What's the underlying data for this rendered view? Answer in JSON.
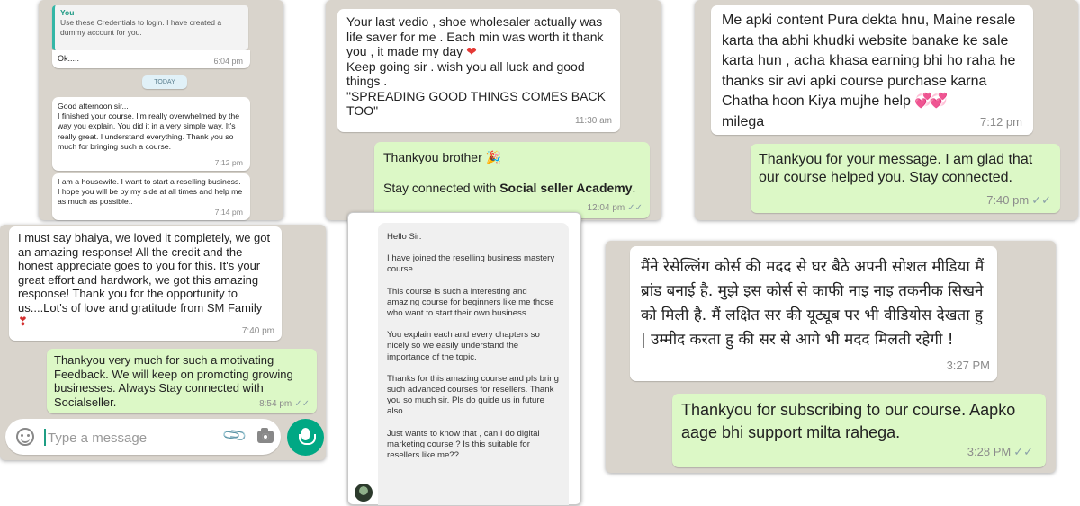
{
  "screenshot1": {
    "quote_author": "You",
    "quote_text": "Use these Credentials to login. I have created a dummy account for you.",
    "reply_text": "Ok.....",
    "reply_time": "6:04 pm",
    "date_separator": "TODAY",
    "msg1_text": "Good afternoon  sir...\n I finished your course. I'm really overwhelmed by the way you explain. You did it in a very simple way. It's really great. I understand everything. Thank you so much for bringing such a course.",
    "msg1_time": "7:12 pm",
    "msg2_text": "I am a housewife. I want to start a reselling business. I hope you will be by my side at all times and help me as much as possible..",
    "msg2_time": "7:14 pm"
  },
  "screenshot2": {
    "msg1_text": "Your last vedio , shoe wholesaler actually was life saver for me . Each min was  worth it thank you , it made my day",
    "msg1_heart": "❤",
    "msg1_text2": "Keep going sir . wish you all luck and good things .\n\"SPREADING GOOD THINGS COMES BACK TOO\"",
    "msg1_time": "11:30 am",
    "msg2_line1": "Thankyou brother",
    "msg2_emoji": "🎉",
    "msg2_line2_prefix": "Stay connected with ",
    "msg2_brand": "Social seller Academy",
    "msg2_line2_suffix": ".",
    "msg2_time": "12:04 pm",
    "ticks": "✓✓"
  },
  "screenshot3": {
    "msg1_text": "Me apki content  Pura dekta hnu, Maine resale karta tha abhi khudki website banake ke sale karta hun , acha khasa earning bhi ho raha he thanks sir avi apki course purchase karna Chatha hoon Kiya mujhe help",
    "msg1_emoji": "💞💞",
    "msg1_text2": "milega",
    "msg1_time": "7:12 pm",
    "msg2_text": "Thankyou for your message. I am glad that our course helped you. Stay connected.",
    "msg2_time": "7:40 pm",
    "ticks": "✓✓"
  },
  "screenshot4": {
    "msg1_text": "I must say bhaiya, we loved it completely, we got an amazing response! All the credit and the honest appreciate goes to you for this. It's your great effort and hardwork, we got this amazing response! Thank you for the opportunity to us....Lot's of love and gratitude from SM Family",
    "msg1_emoji": "❣",
    "msg1_time": "7:40 pm",
    "msg2_text": "Thankyou very much for such a motivating Feedback. We will keep on promoting growing businesses. Always Stay connected with Socialseller.",
    "msg2_time": "8:54 pm",
    "ticks": "✓✓",
    "input_placeholder": "Type a message",
    "attach_glyph": "📎"
  },
  "screenshot5": {
    "paragraphs": [
      "Hello Sir.",
      "I have joined the reselling business mastery course.",
      "This course is such a interesting and amazing course for beginners like me those who want to start their own business.",
      "You explain each and every chapters so nicely so we easily understand the importance of the topic.",
      "Thanks for this amazing course and pls bring such advanced courses for resellers. Thank you so much sir. Pls do guide us in future also.",
      "Just wants to know that , can I do digital marketing course ? Is this suitable for resellers like me??"
    ]
  },
  "screenshot6": {
    "msg1_text": "मैंने रेसेल्लिंग कोर्स की मदद से घर बैठे अपनी सोशल मीडिया मैं ब्रांड बनाई है. मुझे इस कोर्स से काफी नाइ नाइ तकनीक सिखने को मिली है. मैं लक्षित सर की यूट्यूब पर भी वीडियोस देखता हु | उम्मीद करता हु की सर से आगे भी मदद मिलती रहेगी !",
    "msg1_time": "3:27 PM",
    "msg2_text": "Thankyou for subscribing to our course. Aapko aage bhi support milta rahega.",
    "msg2_time": "3:28 PM",
    "ticks": "✓✓"
  },
  "colors": {
    "incoming_bubble": "#ffffff",
    "outgoing_bubble": "#dcf8c6",
    "chat_background": "#d9d4cc",
    "send_button": "#00a884",
    "quote_accent": "#1e9a84"
  }
}
